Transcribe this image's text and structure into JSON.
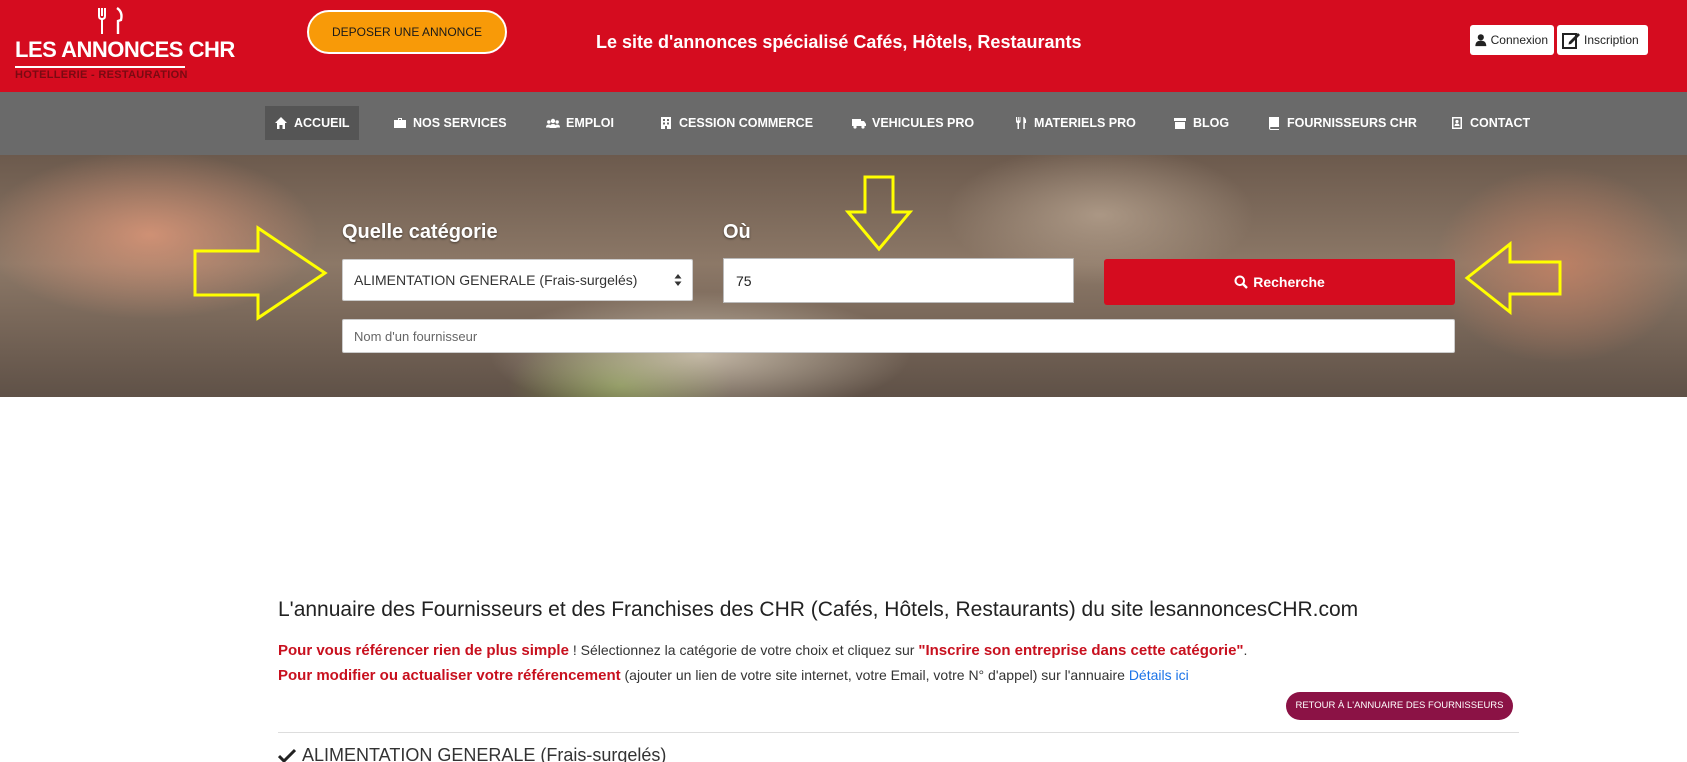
{
  "header": {
    "logo_main": "LES ANNONCES CHR",
    "logo_sub": "HOTELLERIE - RESTAURATION",
    "deposit_label": "DEPOSER UNE ANNONCE",
    "tagline": "Le site d'annonces spécialisé Cafés, Hôtels, Restaurants",
    "login_label": "Connexion",
    "signup_label": "Inscription",
    "brand_red": "#d50c1f",
    "deposit_color": "#f89a08"
  },
  "nav": {
    "items": [
      {
        "label": "ACCUEIL",
        "icon": "home-icon",
        "active": true
      },
      {
        "label": "NOS SERVICES",
        "icon": "briefcase-icon"
      },
      {
        "label": "EMPLOI",
        "icon": "users-icon"
      },
      {
        "label": "CESSION COMMERCE",
        "icon": "building-icon"
      },
      {
        "label": "VEHICULES PRO",
        "icon": "truck-icon"
      },
      {
        "label": "MATERIELS PRO",
        "icon": "utensils-icon"
      },
      {
        "label": "BLOG",
        "icon": "archive-icon"
      },
      {
        "label": "FOURNISSEURS CHR",
        "icon": "book-icon"
      },
      {
        "label": "CONTACT",
        "icon": "contact-card-icon"
      }
    ]
  },
  "search": {
    "category_label": "Quelle catégorie",
    "category_value": "ALIMENTATION GENERALE (Frais-surgelés)",
    "where_label": "Où",
    "where_value": "75",
    "button_label": "Recherche",
    "supplier_placeholder": "Nom d'un fournisseur",
    "annotation_arrow_color": "#ffff00"
  },
  "content": {
    "title": "L'annuaire des Fournisseurs et des Franchises des CHR (Cafés, Hôtels, Restaurants) du site lesannoncesCHR.com",
    "line1_strong": "Pour vous référencer rien de plus simple",
    "line1_text": " ! Sélectionnez la catégorie de votre choix et cliquez sur ",
    "line1_quote": "\"Inscrire son entreprise dans cette catégorie\"",
    "line1_end": ".",
    "line2_strong": "Pour modifier ou actualiser votre référencement",
    "line2_text": " (ajouter un lien de votre site internet, votre Email, votre N° d'appel) sur l'annuaire ",
    "line2_link": "Détails ici",
    "back_button": "RETOUR À L'ANNUAIRE DES FOURNISSEURS",
    "category_heading": "ALIMENTATION GENERALE (Frais-surgelés)"
  }
}
